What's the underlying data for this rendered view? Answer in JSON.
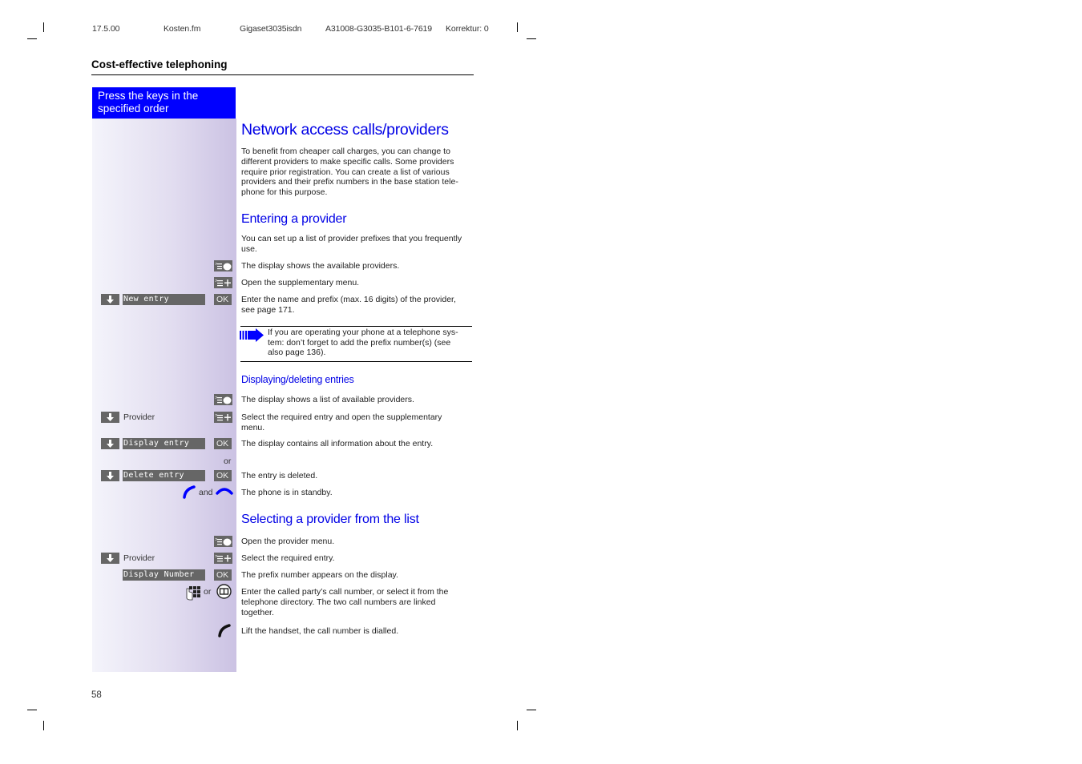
{
  "header": {
    "date": "17.5.00",
    "file": "Kosten.fm",
    "product": "Gigaset3035isdn",
    "doc_id": "A31008-G3035-B101-6-7619",
    "correction": "Korrektur: 0"
  },
  "section_title": "Cost-effective telephoning",
  "instruction_box": {
    "line1": "Press the keys in the",
    "line2": "specified order"
  },
  "main": {
    "title": "Network access calls/providers",
    "intro": "To benefit from cheaper call charges, you can change to different providers to make specific calls. Some providers require prior registration. You can create a list of various providers and their prefix numbers in the base station tele-phone for this purpose.",
    "intro_lines": [
      "To benefit from cheaper call charges, you can change to",
      "different providers to make specific calls. Some providers",
      "require prior registration. You can create a list of various",
      "providers and their prefix numbers in the base station tele-",
      "phone for this purpose."
    ],
    "entering": {
      "title": "Entering a provider",
      "intro_lines": [
        "You can set up a list of provider prefixes that you frequently",
        "use."
      ],
      "steps": [
        {
          "key": "provider-menu-key",
          "text": "The display shows the available providers."
        },
        {
          "key": "supplementary-menu-key",
          "text": "Open the supplementary menu."
        },
        {
          "arrow": true,
          "display": "New entry",
          "key": "OK",
          "text_lines": [
            "Enter the name and prefix (max. 16 digits) of the provider,",
            "see page 171."
          ]
        }
      ],
      "note_lines": [
        "If you are operating your phone at a telephone sys-",
        "tem: don’t forget to add the prefix number(s) (see",
        "also page 136)."
      ]
    },
    "displaying": {
      "title": "Displaying/deleting entries",
      "steps": [
        {
          "key": "provider-menu-key",
          "text": "The display shows a list of available providers."
        },
        {
          "arrow": true,
          "label": "Provider",
          "key": "supplementary-menu-key",
          "text_lines": [
            "Select the required entry and open the supplementary",
            "menu."
          ]
        },
        {
          "arrow": true,
          "display": "Display entry",
          "key": "OK",
          "text": "The display contains all information about the entry."
        },
        {
          "separator": "or"
        },
        {
          "arrow": true,
          "display": "Delete entry",
          "key": "OK",
          "text": "The entry is deleted."
        },
        {
          "icons": [
            "handset-lift",
            "handset-down"
          ],
          "connector": "and",
          "text": "The phone is in standby."
        }
      ]
    },
    "selecting": {
      "title": "Selecting a provider from the list",
      "steps": [
        {
          "key": "provider-menu-key",
          "text": "Open the provider menu."
        },
        {
          "arrow": true,
          "label": "Provider",
          "key": "supplementary-menu-key",
          "text": "Select the required entry."
        },
        {
          "display": "Display Number",
          "key": "OK",
          "text": "The prefix number appears on the display."
        },
        {
          "icons": [
            "keypad",
            "directory"
          ],
          "connector": "or",
          "text_lines": [
            "Enter the called party’s call number, or select it from the",
            "telephone directory. The two call numbers are linked",
            "together."
          ]
        },
        {
          "icons": [
            "handset-lift"
          ],
          "text": "Lift the handset, the call number is dialled."
        }
      ]
    }
  },
  "ok_label": "OK",
  "page_number": "58",
  "colors": {
    "accent_blue": "#0000ff",
    "heading_blue": "#0000e6",
    "key_gray": "#666666"
  }
}
